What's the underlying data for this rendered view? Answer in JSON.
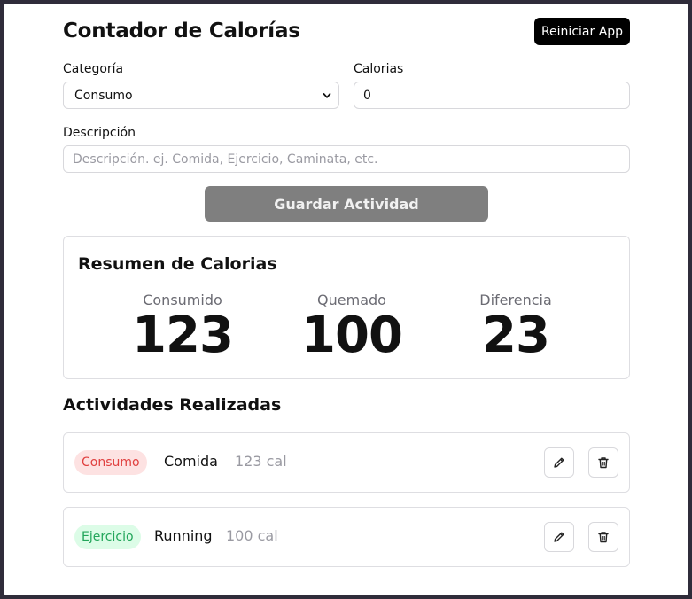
{
  "app": {
    "title": "Contador de Calorías",
    "reset_label": "Reiniciar App"
  },
  "form": {
    "category_label": "Categoría",
    "category_value": "Consumo",
    "calories_label": "Calorias",
    "calories_value": "0",
    "description_label": "Descripción",
    "description_placeholder": "Descripción. ej. Comida, Ejercicio, Caminata, etc.",
    "save_label": "Guardar Actividad"
  },
  "summary": {
    "title": "Resumen de Calorias",
    "stats": [
      {
        "label": "Consumido",
        "value": "123"
      },
      {
        "label": "Quemado",
        "value": "100"
      },
      {
        "label": "Diferencia",
        "value": "23"
      }
    ]
  },
  "activities": {
    "title": "Actividades Realizadas",
    "items": [
      {
        "category": "Consumo",
        "name": "Comida",
        "calories": "123 cal",
        "badge_bg": "#fde2e2",
        "badge_fg": "#e0403f"
      },
      {
        "category": "Ejercicio",
        "name": "Running",
        "calories": "100 cal",
        "badge_bg": "#dcfce7",
        "badge_fg": "#22a55a"
      }
    ]
  },
  "icons": {
    "edit": "pencil-icon",
    "delete": "trash-icon",
    "dropdown": "chevron-down-icon"
  }
}
